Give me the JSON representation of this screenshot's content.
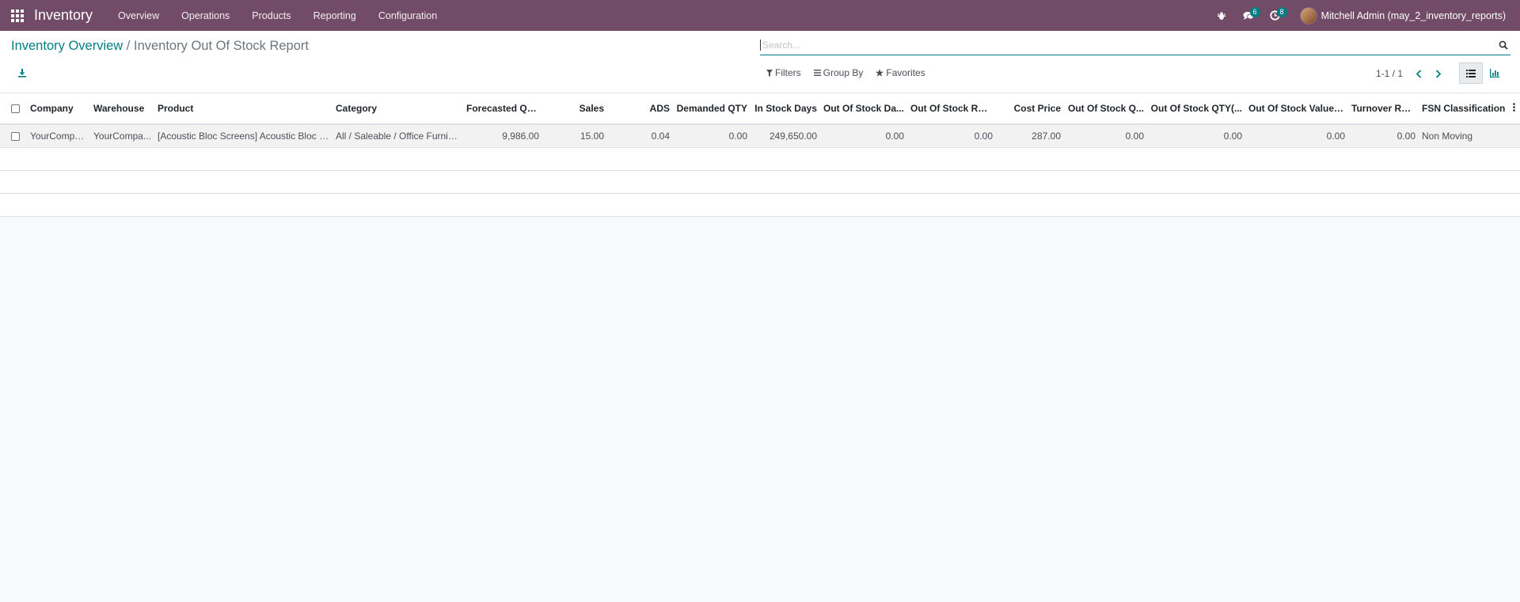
{
  "navbar": {
    "app_name": "Inventory",
    "menu": [
      "Overview",
      "Operations",
      "Products",
      "Reporting",
      "Configuration"
    ],
    "chat_badge": "6",
    "activity_badge": "8",
    "user_name": "Mitchell Admin (may_2_inventory_reports)",
    "bg_color": "#714b67"
  },
  "breadcrumb": {
    "parent": "Inventory Overview",
    "separator": " / ",
    "current": "Inventory Out Of Stock Report"
  },
  "search": {
    "placeholder": "Search...",
    "value": ""
  },
  "filters": {
    "filters_label": "Filters",
    "groupby_label": "Group By",
    "favorites_label": "Favorites"
  },
  "pager": {
    "text": "1-1 / 1"
  },
  "table": {
    "columns": [
      "Company",
      "Warehouse",
      "Product",
      "Category",
      "Forecasted QTY",
      "Sales",
      "ADS",
      "Demanded QTY",
      "In Stock Days",
      "Out Of Stock Da...",
      "Out Of Stock Ratio",
      "Cost Price",
      "Out Of Stock Q...",
      "Out Of Stock QTY(...",
      "Out Of Stock Value(...",
      "Turnover Rat...",
      "FSN Classification"
    ],
    "rows": [
      [
        "YourCompa...",
        "YourCompa...",
        "[Acoustic Bloc Screens] Acoustic Bloc S...",
        "All / Saleable / Office Furnitu...",
        "9,986.00",
        "15.00",
        "0.04",
        "0.00",
        "249,650.00",
        "0.00",
        "0.00",
        "287.00",
        "0.00",
        "0.00",
        "0.00",
        "0.00",
        "Non Moving"
      ]
    ]
  },
  "colors": {
    "accent": "#017e84",
    "brand": "#714b67"
  }
}
